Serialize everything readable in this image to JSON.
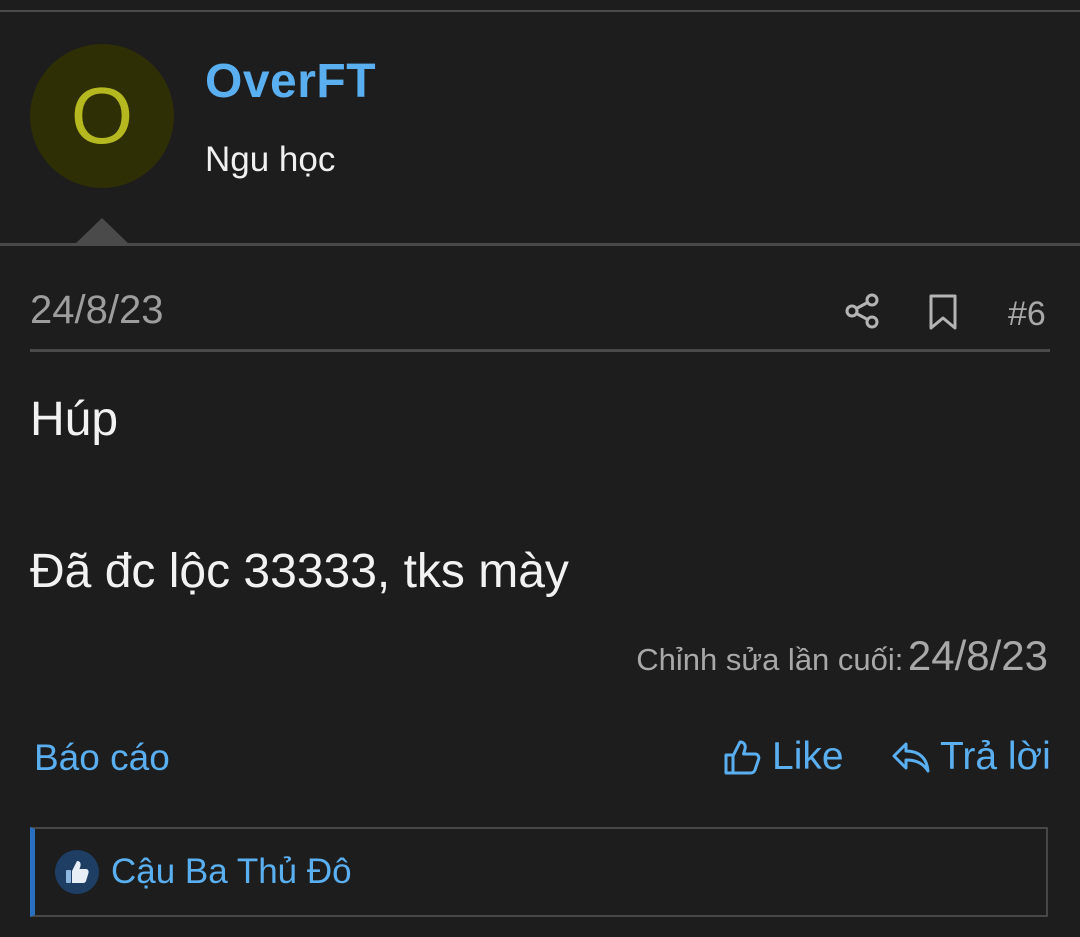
{
  "post": {
    "author": {
      "avatar_letter": "O",
      "username": "OverFT",
      "title": "Ngu học"
    },
    "date": "24/8/23",
    "number": "#6",
    "body_lines": [
      "Húp",
      "Đã đc lộc 33333, tks mày"
    ],
    "edited": {
      "label": "Chỉnh sửa lần cuối:",
      "date": "24/8/23"
    },
    "actions": {
      "report": "Báo cáo",
      "like": "Like",
      "reply": "Trả lời"
    },
    "reactions": {
      "user": "Cậu Ba Thủ Đô",
      "icon": "thumbs-up-icon"
    },
    "icons": {
      "share": "share-icon",
      "bookmark": "bookmark-icon",
      "like": "thumbs-up-icon",
      "reply": "reply-arrow-icon"
    }
  },
  "colors": {
    "background": "#1d1d1d",
    "accent": "#5aaff0",
    "avatar_bg": "#2f2f06",
    "avatar_letter": "#b5b81f",
    "divider": "#4a4a4a",
    "reaction_bar_accent": "#2b6fc0"
  }
}
